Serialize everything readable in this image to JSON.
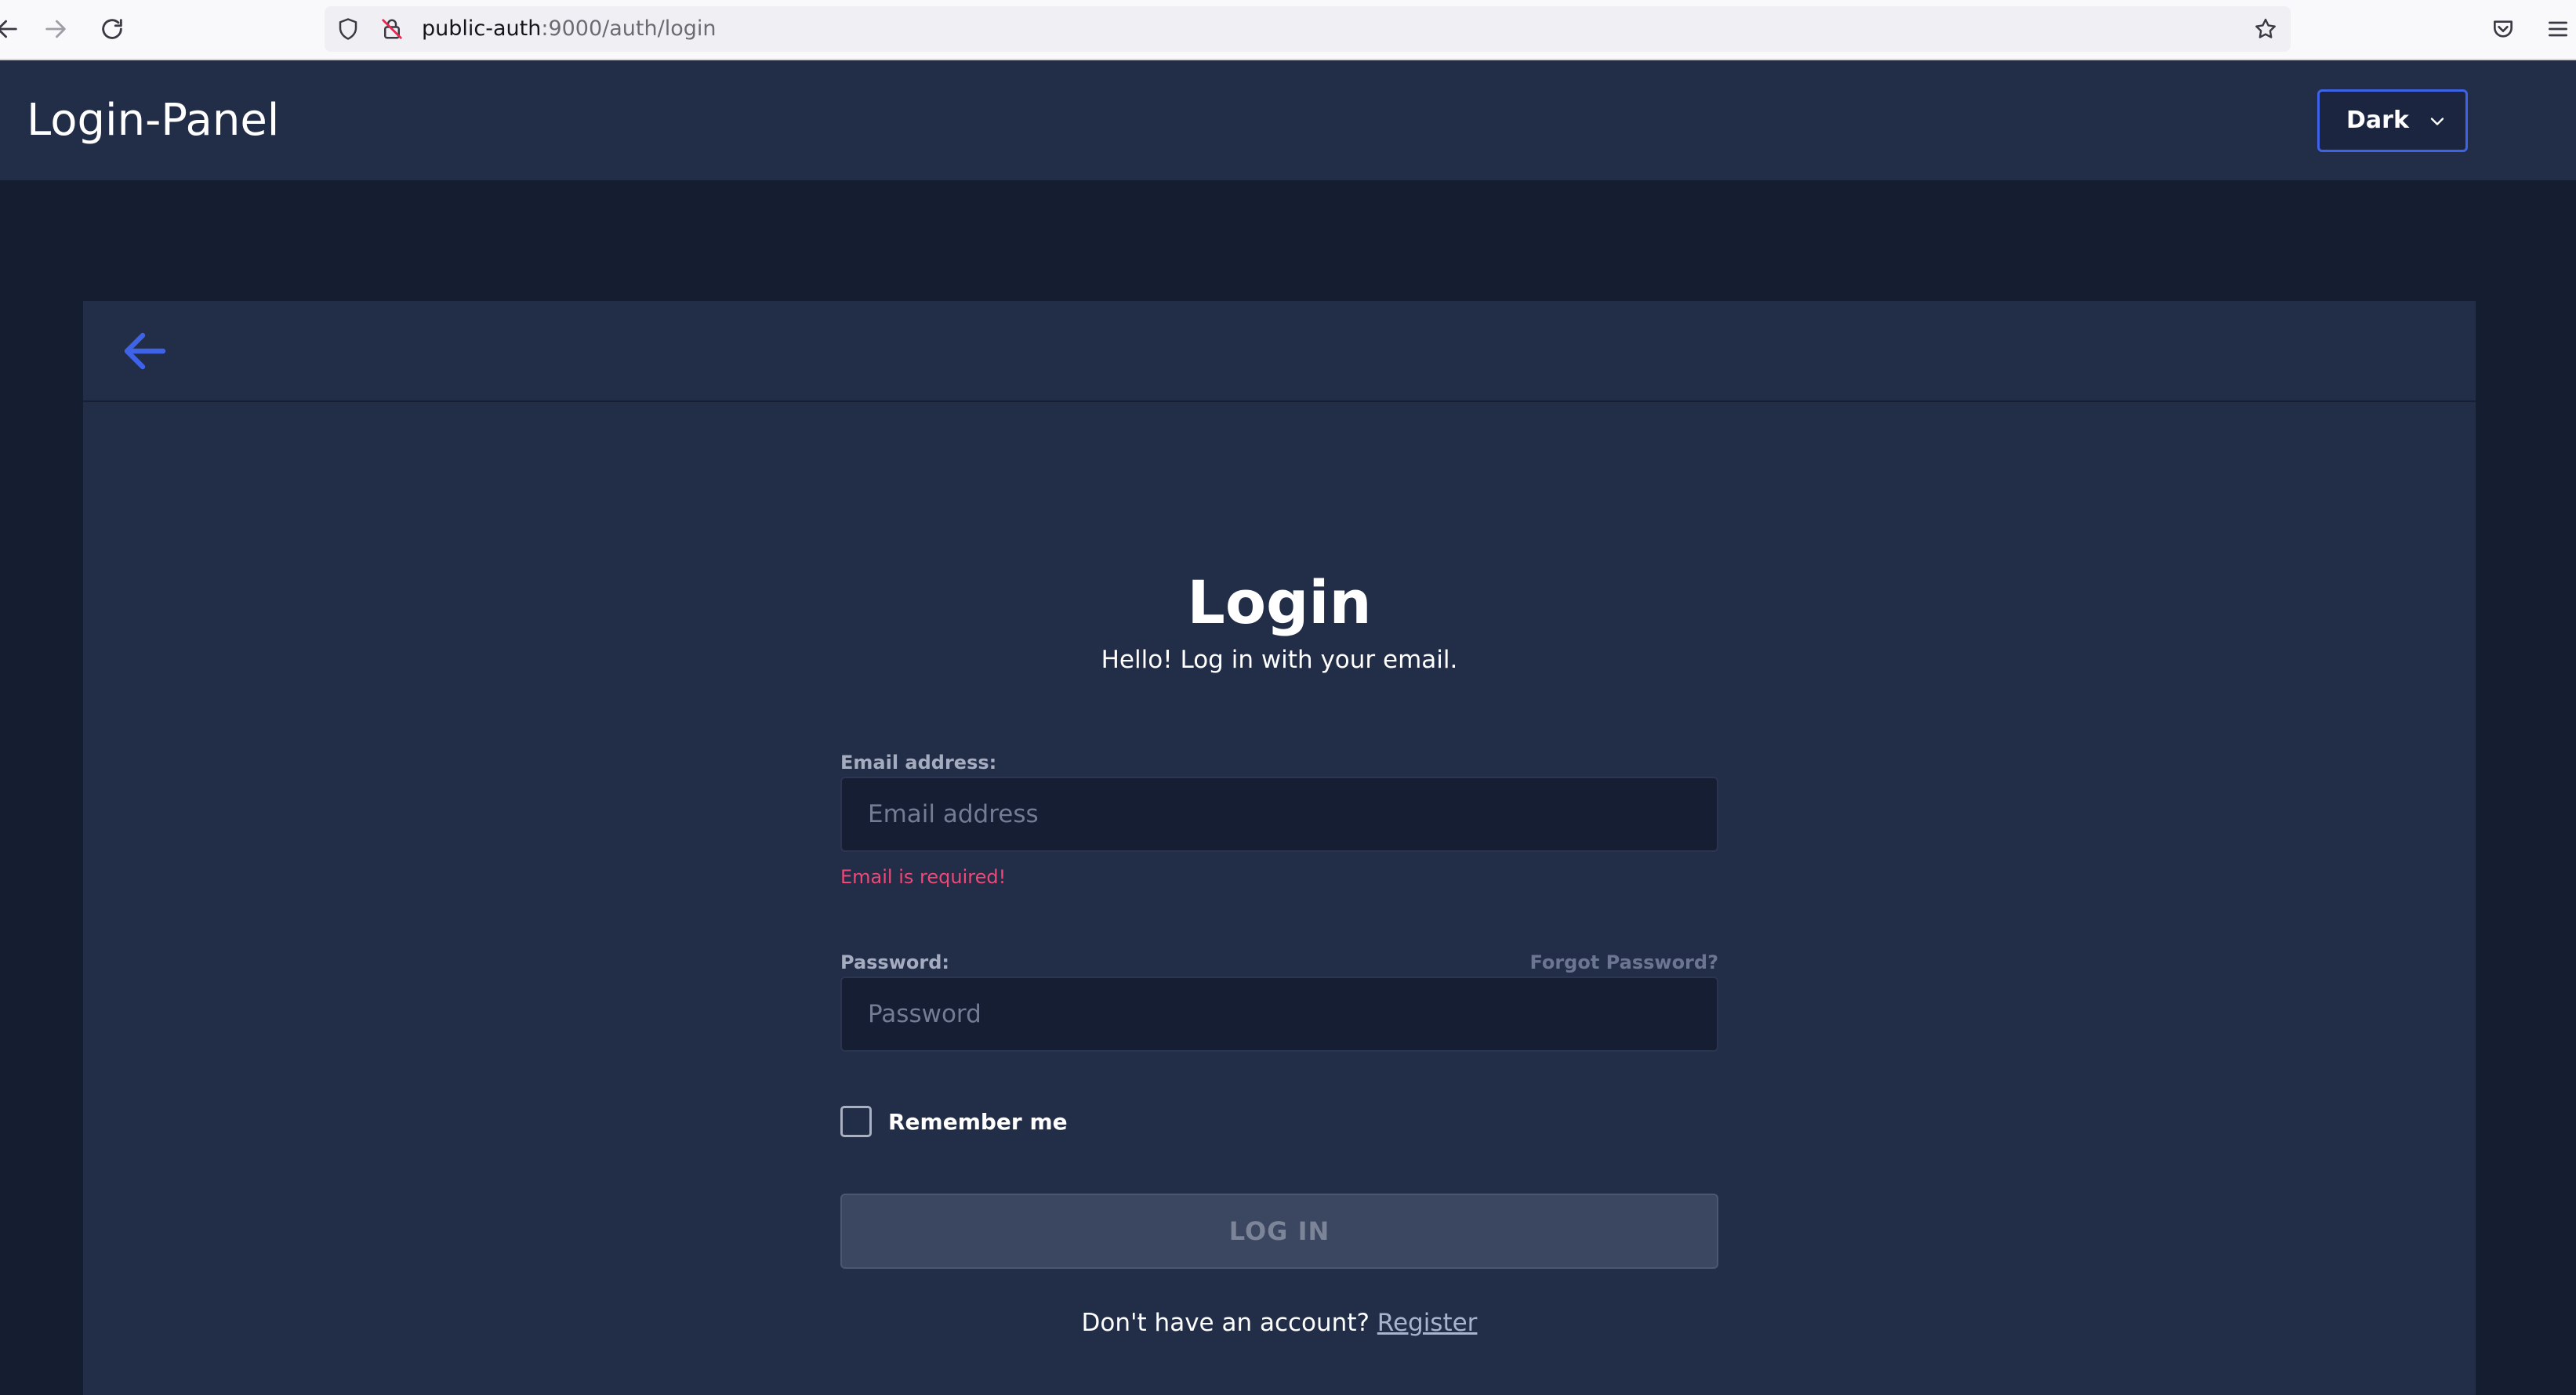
{
  "browser": {
    "url_host": "public-auth",
    "url_rest": ":9000/auth/login"
  },
  "header": {
    "title": "Login-Panel",
    "theme_select": {
      "selected": "Dark"
    }
  },
  "login": {
    "title": "Login",
    "subtitle": "Hello! Log in with your email.",
    "email": {
      "label": "Email address:",
      "placeholder": "Email address",
      "value": "",
      "error": "Email is required!"
    },
    "password": {
      "label": "Password:",
      "placeholder": "Password",
      "value": "",
      "forgot_label": "Forgot Password?"
    },
    "remember": {
      "label": "Remember me",
      "checked": false
    },
    "submit_label": "LOG IN",
    "register": {
      "prompt": "Don't have an account?",
      "link_label": "Register"
    }
  },
  "icons": {
    "back": "arrow-left-icon",
    "theme_dropdown": "chevron-down-icon",
    "browser_back": "arrow-left-icon",
    "browser_forward": "arrow-right-icon",
    "browser_reload": "reload-icon",
    "tracking_protection": "shield-icon",
    "insecure_connection": "lock-slash-icon",
    "bookmark": "star-icon",
    "pocket": "pocket-icon",
    "menu": "hamburger-menu-icon"
  },
  "colors": {
    "accent": "#3f63e6",
    "error": "#f04878",
    "card_background": "#222d47",
    "page_background": "#151d30"
  }
}
